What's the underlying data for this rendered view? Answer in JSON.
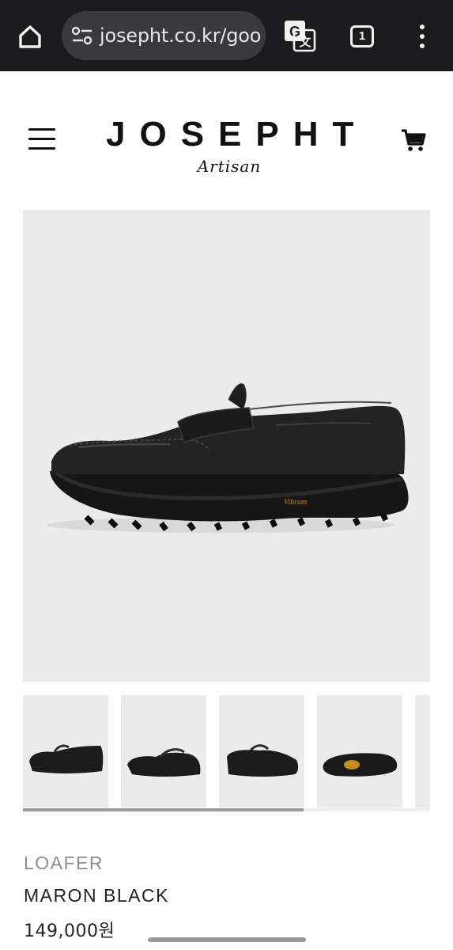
{
  "browser": {
    "url": "josepht.co.kr/goo",
    "tab_count": "1",
    "colors": {
      "chrome_bg": "#1b1b1d",
      "urlbar_bg": "#3a3a3e"
    }
  },
  "site": {
    "brand": "JOSEPHT",
    "brand_sub": "Artisan"
  },
  "product": {
    "category": "LOAFER",
    "name": "MARON BLACK",
    "price": "149,000원",
    "sole_brand": "Vibram"
  },
  "gallery": {
    "thumbnail_count": 5,
    "scroll_position": 0.69
  }
}
